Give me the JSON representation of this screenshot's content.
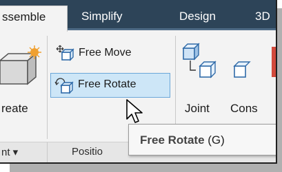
{
  "tabs": [
    {
      "label": "ssemble",
      "active": true
    },
    {
      "label": "Simplify",
      "active": false
    },
    {
      "label": "Design",
      "active": false
    },
    {
      "label": "3D",
      "active": false
    }
  ],
  "buttons": {
    "create_label": "reate",
    "free_move_label": "Free Move",
    "free_rotate_label": "Free Rotate",
    "joint_label": "Joint",
    "constrain_label": "Cons"
  },
  "groups": {
    "component_label": "nt ▾",
    "position_label": "Positio"
  },
  "tooltip": {
    "title": "Free Rotate",
    "shortcut": "(G)"
  },
  "colors": {
    "tabbar": "#2d4458",
    "hover_fill": "#cde6f7",
    "hover_border": "#6aa6d8",
    "icon_blue": "#4a86c8",
    "icon_orange": "#f0a030"
  }
}
